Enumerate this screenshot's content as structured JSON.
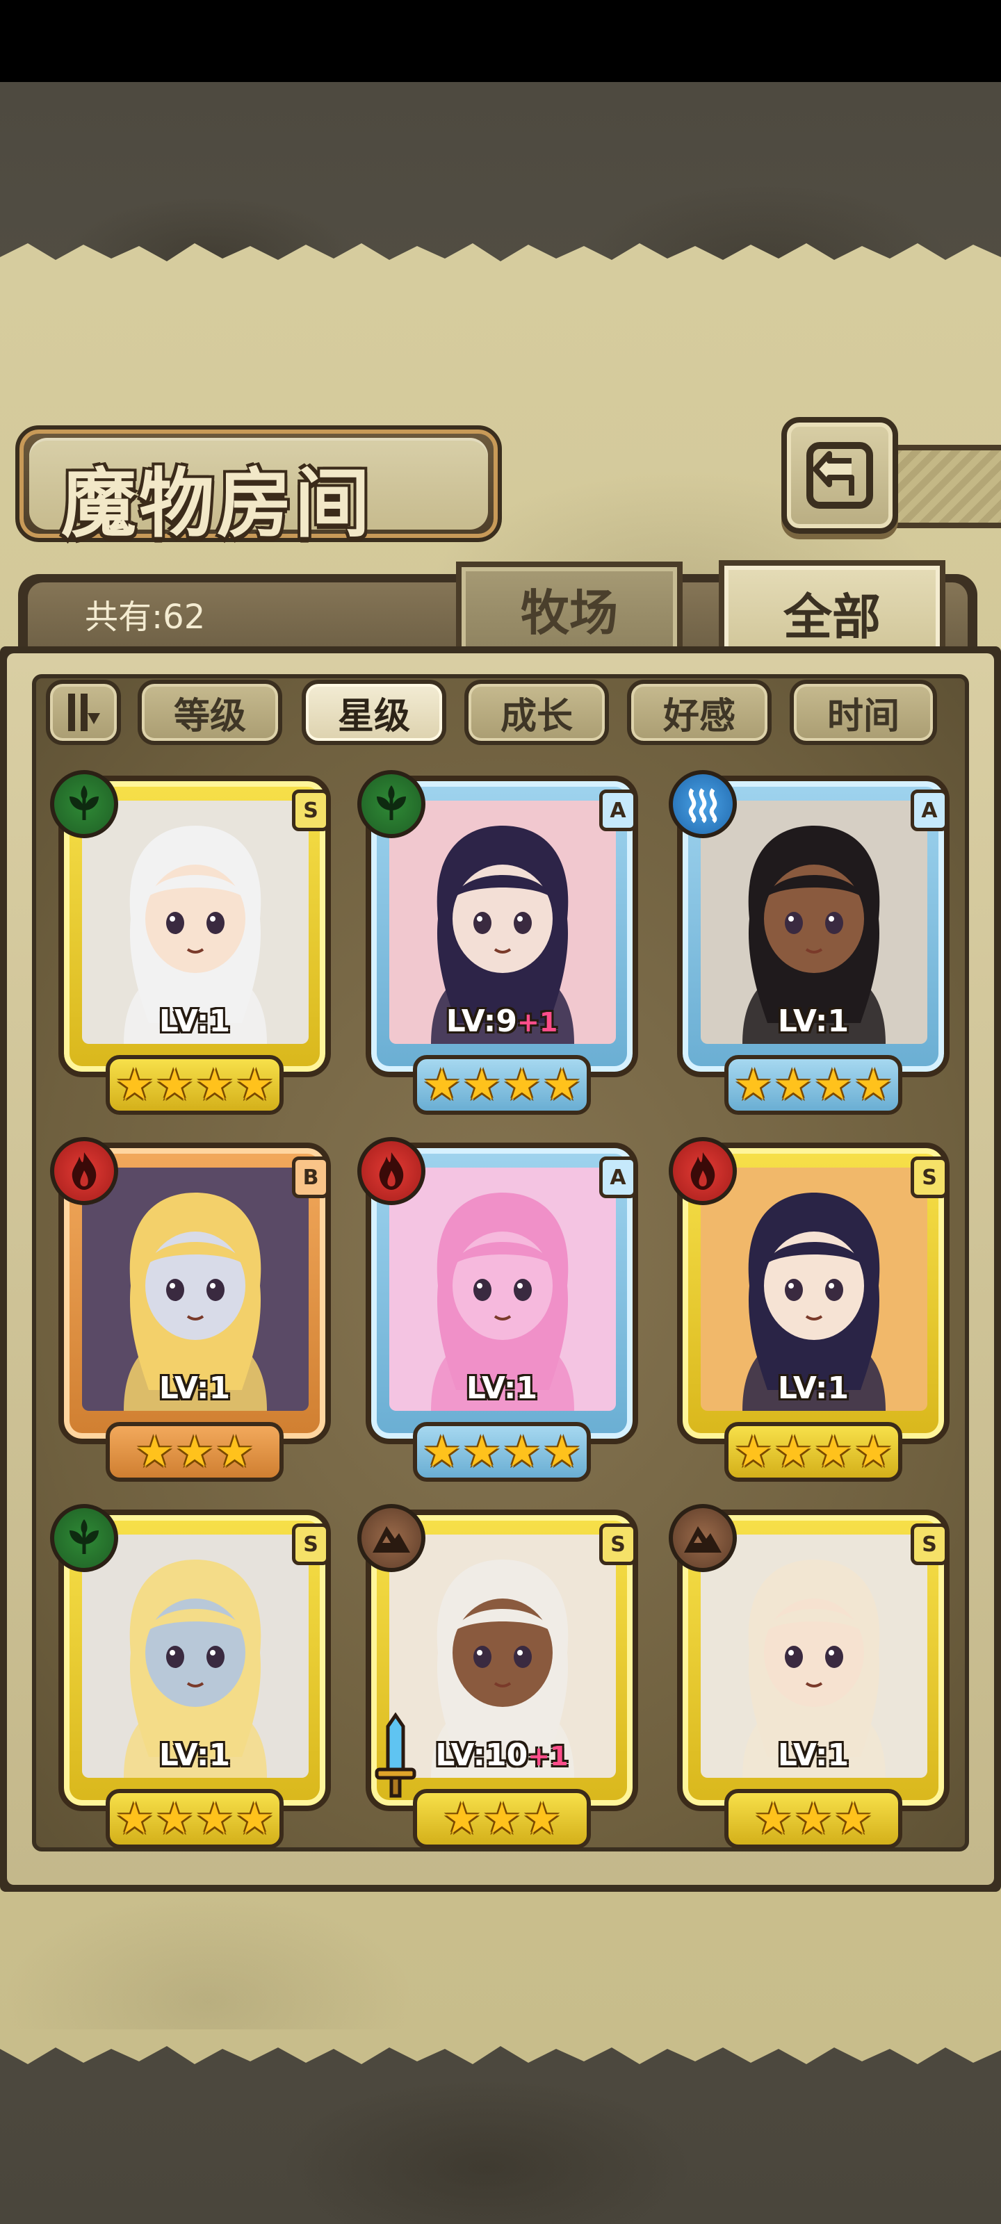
{
  "page": {
    "title": "魔物房间",
    "count_text": "共有:62",
    "back_icon": "back-arrow-icon"
  },
  "tabs": [
    {
      "label": "牧场",
      "active": false
    },
    {
      "label": "全部",
      "active": true
    }
  ],
  "sort": {
    "toggle_icon": "sort-toggle-icon",
    "buttons": [
      {
        "label": "等级",
        "active": false
      },
      {
        "label": "星级",
        "active": true
      },
      {
        "label": "成长",
        "active": false
      },
      {
        "label": "好感",
        "active": false
      },
      {
        "label": "时间",
        "active": false
      }
    ]
  },
  "cards": [
    {
      "rank": "S",
      "element": "grass",
      "level": "LV:1",
      "bonus": "",
      "stars": 4,
      "tier": "gold",
      "hair": "#f2f2f2",
      "skin": "#f8e2d0",
      "bg": "#e8e4dc"
    },
    {
      "rank": "A",
      "element": "grass",
      "level": "LV:9",
      "bonus": "+1",
      "stars": 4,
      "tier": "blue",
      "hair": "#2d2448",
      "skin": "#f3dfd6",
      "bg": "#f1c8cf"
    },
    {
      "rank": "A",
      "element": "water",
      "level": "LV:1",
      "bonus": "",
      "stars": 4,
      "tier": "blue",
      "hair": "#1f1a1c",
      "skin": "#8a5a3e",
      "bg": "#d6cfc4"
    },
    {
      "rank": "B",
      "element": "fire",
      "level": "LV:1",
      "bonus": "",
      "stars": 3,
      "tier": "orange",
      "hair": "#f3d06a",
      "skin": "#d8dbe8",
      "bg": "#5a4a66"
    },
    {
      "rank": "A",
      "element": "fire",
      "level": "LV:1",
      "bonus": "",
      "stars": 4,
      "tier": "blue",
      "hair": "#f090c8",
      "skin": "#f6b9dd",
      "bg": "#f4c4e2"
    },
    {
      "rank": "S",
      "element": "fire",
      "level": "LV:1",
      "bonus": "",
      "stars": 4,
      "tier": "gold",
      "hair": "#2a2446",
      "skin": "#f6e3d4",
      "bg": "#f1b86a"
    },
    {
      "rank": "S",
      "element": "grass",
      "level": "LV:1",
      "bonus": "",
      "stars": 4,
      "tier": "gold",
      "hair": "#f4dc88",
      "skin": "#b8c8d8",
      "bg": "#e6e2dc"
    },
    {
      "rank": "S",
      "element": "earth",
      "level": "LV:10",
      "bonus": "+1",
      "stars": 3,
      "tier": "gold",
      "hair": "#f0ece6",
      "skin": "#8a5a3e",
      "bg": "#efe6d8",
      "weapon": "sword-icon"
    },
    {
      "rank": "S",
      "element": "earth",
      "level": "LV:1",
      "bonus": "",
      "stars": 3,
      "tier": "gold",
      "hair": "#f2e6d2",
      "skin": "#f6e2d0",
      "bg": "#ece6da"
    }
  ]
}
